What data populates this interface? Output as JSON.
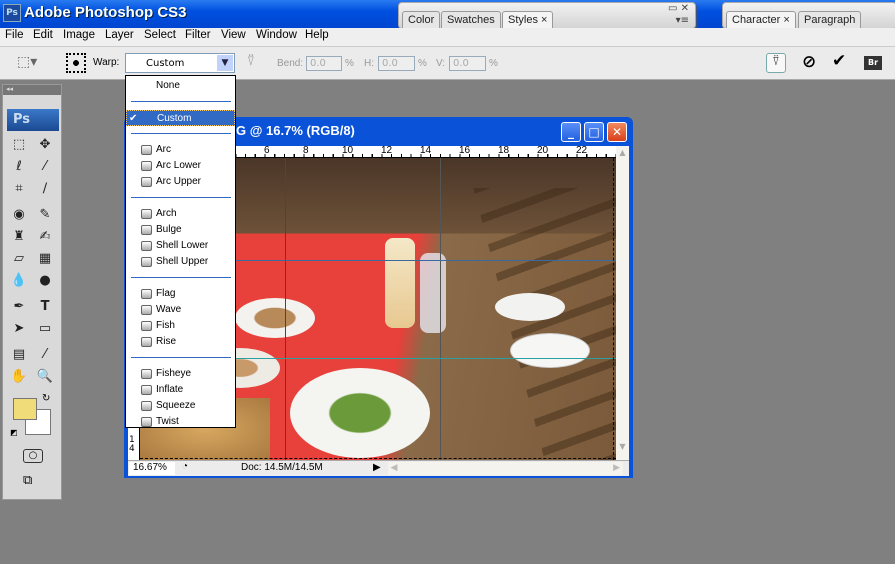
{
  "app": {
    "title": "Adobe Photoshop CS3",
    "logo": "Ps"
  },
  "panels": {
    "group1": [
      "Color",
      "Swatches",
      "Styles"
    ],
    "group2": [
      "Character",
      "Paragraph"
    ]
  },
  "menu": [
    "File",
    "Edit",
    "Image",
    "Layer",
    "Select",
    "Filter",
    "View",
    "Window",
    "Help"
  ],
  "options": {
    "warp_label": "Warp:",
    "warp_value": "Custom",
    "bend_label": "Bend:",
    "bend": "0.0",
    "h_label": "H:",
    "h": "0.0",
    "v_label": "V:",
    "v": "0.0",
    "percent": "%",
    "bridge": "Br"
  },
  "warp_menu": [
    {
      "label": "None"
    },
    {
      "sep": true
    },
    {
      "label": "Custom",
      "selected": true,
      "check": "✔"
    },
    {
      "sep": true
    },
    {
      "label": "Arc"
    },
    {
      "label": "Arc Lower"
    },
    {
      "label": "Arc Upper"
    },
    {
      "sep": true
    },
    {
      "label": "Arch"
    },
    {
      "label": "Bulge"
    },
    {
      "label": "Shell Lower"
    },
    {
      "label": "Shell Upper"
    },
    {
      "sep": true
    },
    {
      "label": "Flag"
    },
    {
      "label": "Wave"
    },
    {
      "label": "Fish"
    },
    {
      "label": "Rise"
    },
    {
      "sep": true
    },
    {
      "label": "Fisheye"
    },
    {
      "label": "Inflate"
    },
    {
      "label": "Squeeze"
    },
    {
      "label": "Twist"
    }
  ],
  "document": {
    "title": "G @ 16.7% (RGB/8)",
    "zoom": "16.67%",
    "doc_size": "Doc: 14.5M/14.5M",
    "ruler": [
      "6",
      "8",
      "10",
      "12",
      "14",
      "16",
      "18",
      "20",
      "22"
    ],
    "vruler": "1 4"
  },
  "colors": {
    "foreground": "#f0dc78",
    "background": "#ffffff",
    "accent": "#316ac5"
  }
}
